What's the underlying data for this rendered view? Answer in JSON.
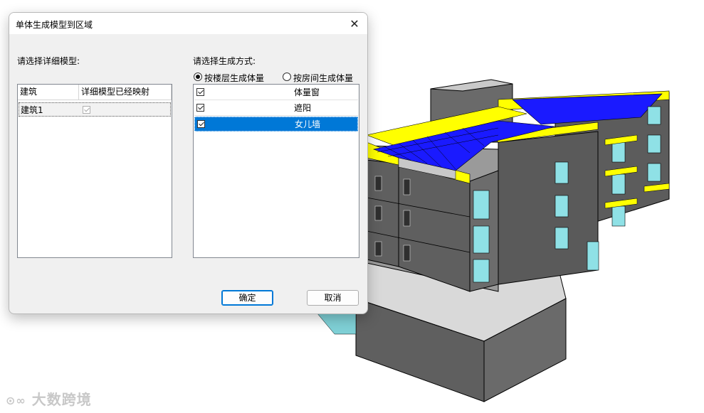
{
  "dialog": {
    "title": "单体生成模型到区域",
    "close_icon": "close-icon"
  },
  "left_panel": {
    "label": "请选择详细模型:",
    "columns": [
      "建筑",
      "详细模型已经映射"
    ],
    "rows": [
      {
        "name": "建筑1",
        "mapped": true
      }
    ]
  },
  "right_panel": {
    "label": "请选择生成方式:",
    "radio_options": [
      {
        "label": "按楼层生成体量",
        "checked": true
      },
      {
        "label": "按房间生成体量",
        "checked": false
      }
    ],
    "methods": [
      {
        "label": "体量窗",
        "checked": true,
        "selected": false
      },
      {
        "label": "遮阳",
        "checked": true,
        "selected": false
      },
      {
        "label": "女儿墙",
        "checked": true,
        "selected": true
      }
    ]
  },
  "buttons": {
    "ok_label": "确定",
    "cancel_label": "取消"
  },
  "watermark": {
    "text": "大数跨境",
    "icon": "logo-icon"
  },
  "colors": {
    "accent": "#0078d7",
    "wall": "#5f5f5f",
    "roof_panel": "#1a1aff",
    "parapet": "#ffff00",
    "window": "#8fe1e6"
  }
}
